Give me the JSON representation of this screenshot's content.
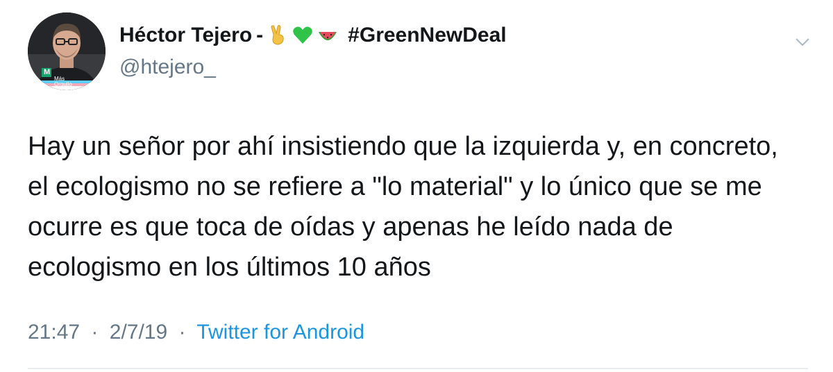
{
  "author": {
    "name": "Héctor Tejero",
    "separator": "-",
    "emojis": [
      "victory-hand-emoji",
      "green-heart-emoji",
      "watermelon-emoji"
    ],
    "hashtag": "#GreenNewDeal",
    "handle": "@htejero_",
    "avatar": {
      "badge_letter": "M",
      "badge_text": "Más Orgullo"
    }
  },
  "tweet": {
    "lines": [
      "Hay un señor por ahí insistiendo que la izquierda y, en concreto,",
      "el ecologismo no se refiere a \"lo material\" y lo único que se me",
      "ocurre es que toca de oídas y apenas he leído nada de",
      "ecologismo en los últimos 10 años"
    ]
  },
  "meta": {
    "time": "21:47",
    "date": "2/7/19",
    "dot": "·",
    "source": "Twitter for Android"
  },
  "colors": {
    "text": "#14171a",
    "secondary": "#657786",
    "link": "#1b95e0",
    "divider": "#e6ecf0"
  }
}
